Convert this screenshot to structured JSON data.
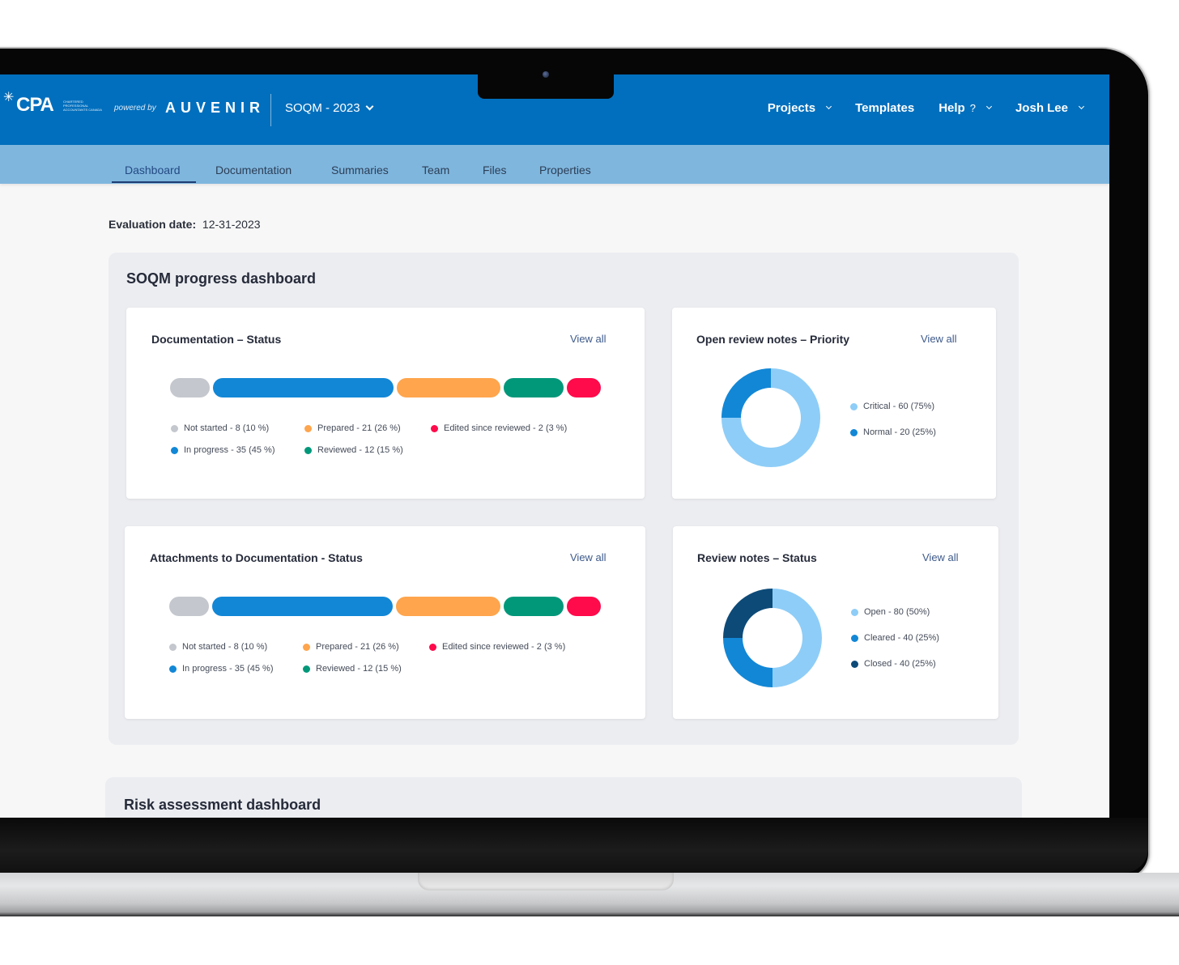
{
  "header": {
    "logo_text": "CPA",
    "logo_subtext": "Chartered Professional Accountants Canada",
    "powered_by": "powered by",
    "brand": "AUVENIR",
    "project_selector": "SOQM - 2023",
    "nav": [
      {
        "label": "Projects",
        "has_dropdown": true
      },
      {
        "label": "Templates",
        "has_dropdown": false
      },
      {
        "label": "Help",
        "icon": "help-icon",
        "has_dropdown": true
      },
      {
        "label": "Josh Lee",
        "has_dropdown": true
      }
    ]
  },
  "tabs": [
    {
      "label": "Dashboard",
      "active": true
    },
    {
      "label": "Documentation",
      "active": false
    },
    {
      "label": "Summaries",
      "active": false
    },
    {
      "label": "Team",
      "active": false
    },
    {
      "label": "Files",
      "active": false
    },
    {
      "label": "Properties",
      "active": false
    }
  ],
  "evaluation": {
    "label": "Evaluation date:",
    "value": "12-31-2023"
  },
  "sections": {
    "progress_title": "SOQM progress dashboard",
    "risk_title": "Risk assessment dashboard"
  },
  "colors": {
    "not_started": "#c4c7cd",
    "in_progress": "#1287d6",
    "prepared": "#fea54d",
    "reviewed": "#01987a",
    "edited": "#ff0a4b",
    "light_blue": "#8ecdf7",
    "mid_blue": "#1287d6",
    "dark_blue": "#0d4a78",
    "header": "#016fbd",
    "subnav": "#7fb6de"
  },
  "chart_data": [
    {
      "type": "bar",
      "title": "Documentation – Status",
      "link": "View all",
      "categories": [
        "Not started",
        "In progress",
        "Prepared",
        "Reviewed",
        "Edited since reviewed"
      ],
      "values": [
        8,
        35,
        21,
        12,
        2
      ],
      "percents": [
        10,
        45,
        26,
        15,
        3
      ],
      "legend": [
        "Not started - 8  (10 %)",
        "In progress - 35  (45 %)",
        "Prepared - 21  (26 %)",
        "Reviewed - 12  (15 %)",
        "Edited since reviewed - 2  (3 %)"
      ]
    },
    {
      "type": "pie",
      "title": "Open review notes – Priority",
      "link": "View all",
      "categories": [
        "Critical",
        "Normal"
      ],
      "values": [
        60,
        20
      ],
      "percents": [
        75,
        25
      ],
      "legend": [
        "Critical - 60  (75%)",
        "Normal - 20  (25%)"
      ]
    },
    {
      "type": "bar",
      "title": "Attachments to Documentation - Status",
      "link": "View all",
      "categories": [
        "Not started",
        "In progress",
        "Prepared",
        "Reviewed",
        "Edited since reviewed"
      ],
      "values": [
        8,
        35,
        21,
        12,
        2
      ],
      "percents": [
        10,
        45,
        26,
        15,
        3
      ],
      "legend": [
        "Not started - 8  (10 %)",
        "In progress - 35  (45 %)",
        "Prepared - 21  (26 %)",
        "Reviewed - 12  (15 %)",
        "Edited since reviewed - 2  (3 %)"
      ]
    },
    {
      "type": "pie",
      "title": "Review notes – Status",
      "link": "View all",
      "categories": [
        "Open",
        "Cleared",
        "Closed"
      ],
      "values": [
        80,
        40,
        40
      ],
      "percents": [
        50,
        25,
        25
      ],
      "legend": [
        "Open - 80  (50%)",
        "Cleared - 40  (25%)",
        "Closed - 40  (25%)"
      ]
    }
  ]
}
